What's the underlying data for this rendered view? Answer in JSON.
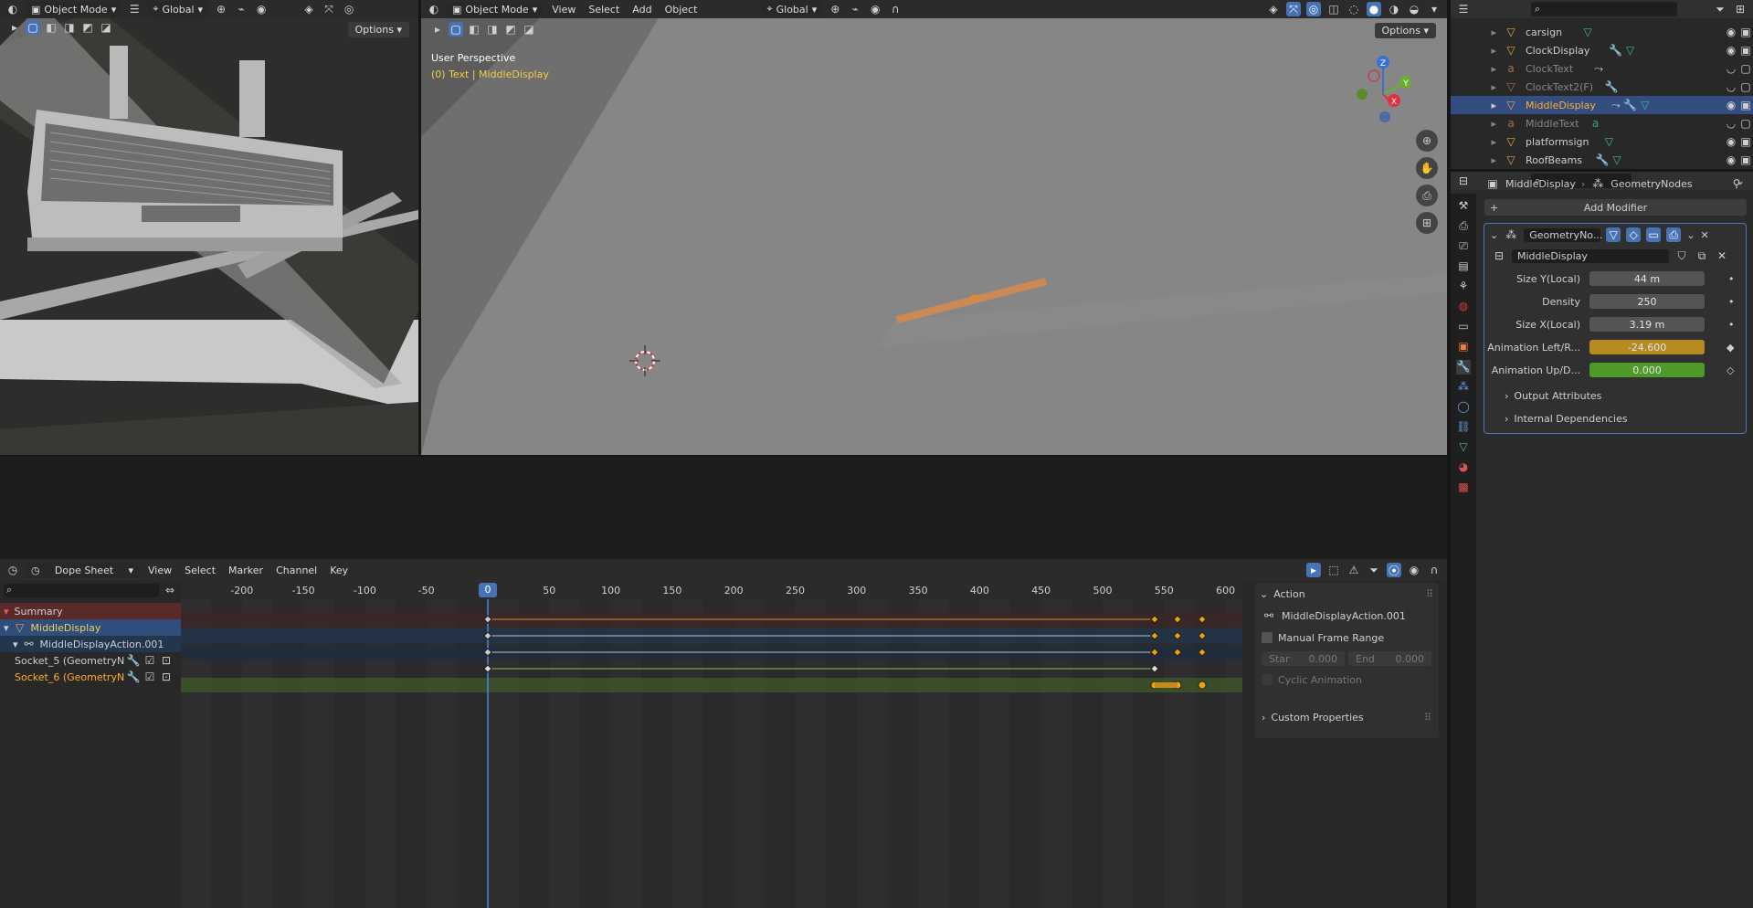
{
  "viewport_left": {
    "mode": "Object Mode",
    "orientation": "Global",
    "options": "Options"
  },
  "viewport_main": {
    "mode": "Object Mode",
    "menu": [
      "View",
      "Select",
      "Add",
      "Object"
    ],
    "orientation": "Global",
    "options": "Options",
    "perspective_label": "User Perspective",
    "object_label": "(0) Text | MiddleDisplay",
    "gizmo": {
      "x": "X",
      "y": "Y",
      "z": "Z"
    }
  },
  "outliner": {
    "items": [
      {
        "name": "carsign",
        "color": "#f0c070",
        "dim": false,
        "selected": false
      },
      {
        "name": "ClockDisplay",
        "color": "#f0c070",
        "dim": false,
        "selected": false
      },
      {
        "name": "ClockText",
        "color": "#a0a0a0",
        "dim": true,
        "selected": false
      },
      {
        "name": "ClockText2(F)",
        "color": "#a0a0a0",
        "dim": true,
        "selected": false
      },
      {
        "name": "MiddleDisplay",
        "color": "#ffaf29",
        "dim": false,
        "selected": true
      },
      {
        "name": "MiddleText",
        "color": "#a0a0a0",
        "dim": true,
        "selected": false
      },
      {
        "name": "platformsign",
        "color": "#f0c070",
        "dim": false,
        "selected": false
      },
      {
        "name": "RoofBeams",
        "color": "#f0c070",
        "dim": false,
        "selected": false
      }
    ]
  },
  "properties": {
    "breadcrumb_object": "MiddleDisplay",
    "breadcrumb_modifier": "GeometryNodes",
    "add_modifier": "Add Modifier",
    "modifier_name": "GeometryNo...",
    "node_group": "MiddleDisplay",
    "fields": [
      {
        "label": "Size Y(Local)",
        "value": "44 m",
        "bg": "#545454"
      },
      {
        "label": "Density",
        "value": "250",
        "bg": "#545454"
      },
      {
        "label": "Size X(Local)",
        "value": "3.19 m",
        "bg": "#545454"
      },
      {
        "label": "Animation Left/R...",
        "value": "-24.600",
        "bg": "#b59028"
      },
      {
        "label": "Animation Up/D...",
        "value": "0.000",
        "bg": "#5a9c2c"
      }
    ],
    "panels": [
      "Output Attributes",
      "Internal Dependencies"
    ]
  },
  "dopesheet": {
    "editor": "Dope Sheet",
    "menu": [
      "View",
      "Select",
      "Marker",
      "Channel",
      "Key"
    ],
    "ruler": [
      "-200",
      "-150",
      "-100",
      "-50",
      "0",
      "50",
      "100",
      "150",
      "200",
      "250",
      "300",
      "350",
      "400",
      "450",
      "500",
      "550",
      "600"
    ],
    "current_frame": "0",
    "channels": [
      {
        "name": "Summary",
        "color": "#e0e0e0"
      },
      {
        "name": "MiddleDisplay",
        "color": "#f0d060"
      },
      {
        "name": "MiddleDisplayAction.001",
        "color": "#e0e0e0"
      },
      {
        "name": "Socket_5 (GeometryNo",
        "color": "#e0e0e0"
      },
      {
        "name": "Socket_6 (GeometryNo",
        "color": "#ffaf29"
      }
    ]
  },
  "action_panel": {
    "title": "Action",
    "action_name": "MiddleDisplayAction.001",
    "manual_frame_range": "Manual Frame Range",
    "start_label": "Star",
    "start_value": "0.000",
    "end_label": "End",
    "end_value": "0.000",
    "cyclic": "Cyclic Animation",
    "custom_properties": "Custom Properties"
  }
}
